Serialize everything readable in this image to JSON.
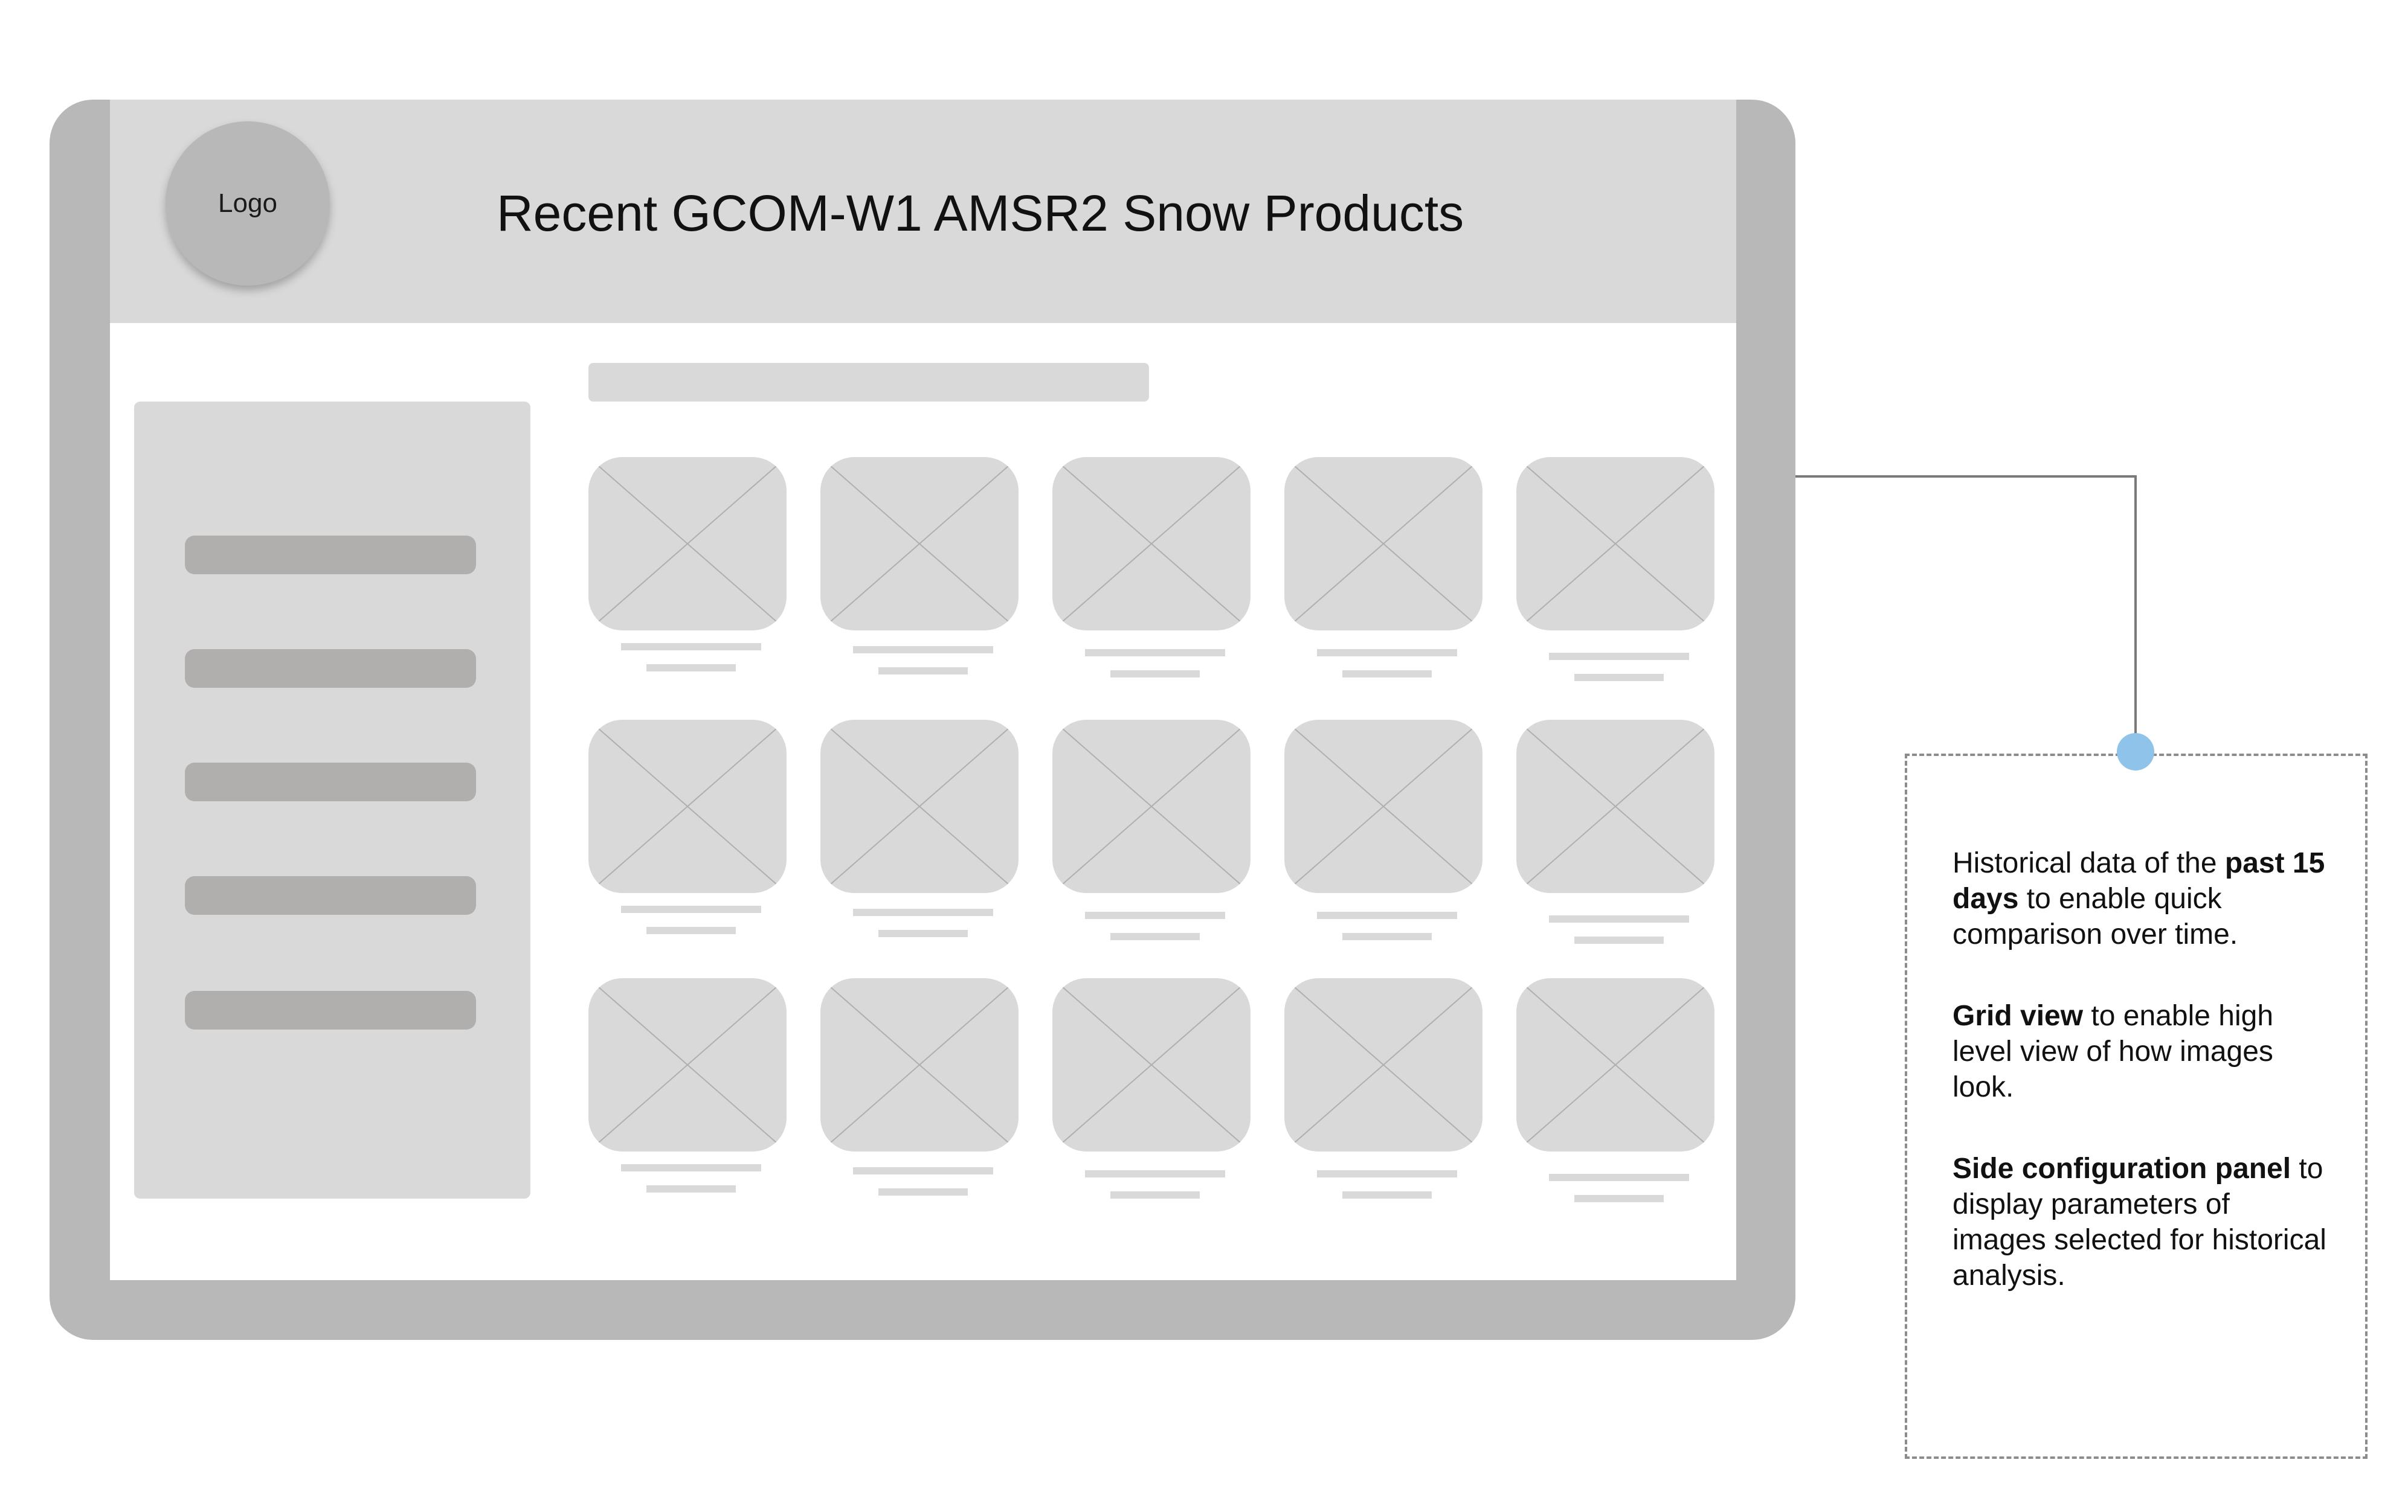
{
  "header": {
    "logo_label": "Logo",
    "title": "Recent GCOM-W1 AMSR2 Snow Products"
  },
  "side_panel": {
    "item_count": 5
  },
  "grid": {
    "rows": 3,
    "columns": 5
  },
  "annotation": {
    "paragraphs": [
      {
        "lead": "Historical data of the ",
        "bold": "past 15 days",
        "tail": " to enable quick comparison over time."
      },
      {
        "lead": "",
        "bold": "Grid view",
        "tail": " to enable high level view of how images look."
      },
      {
        "lead": "",
        "bold": "Side configuration panel",
        "tail": " to display parameters  of images selected for historical analysis."
      }
    ]
  },
  "colors": {
    "device_frame": "#b8b8b8",
    "placeholder": "#d9d9d9",
    "side_item": "#b1afae",
    "connector_dot": "#8fc3ea",
    "dashed_border": "#8c8c8c"
  }
}
